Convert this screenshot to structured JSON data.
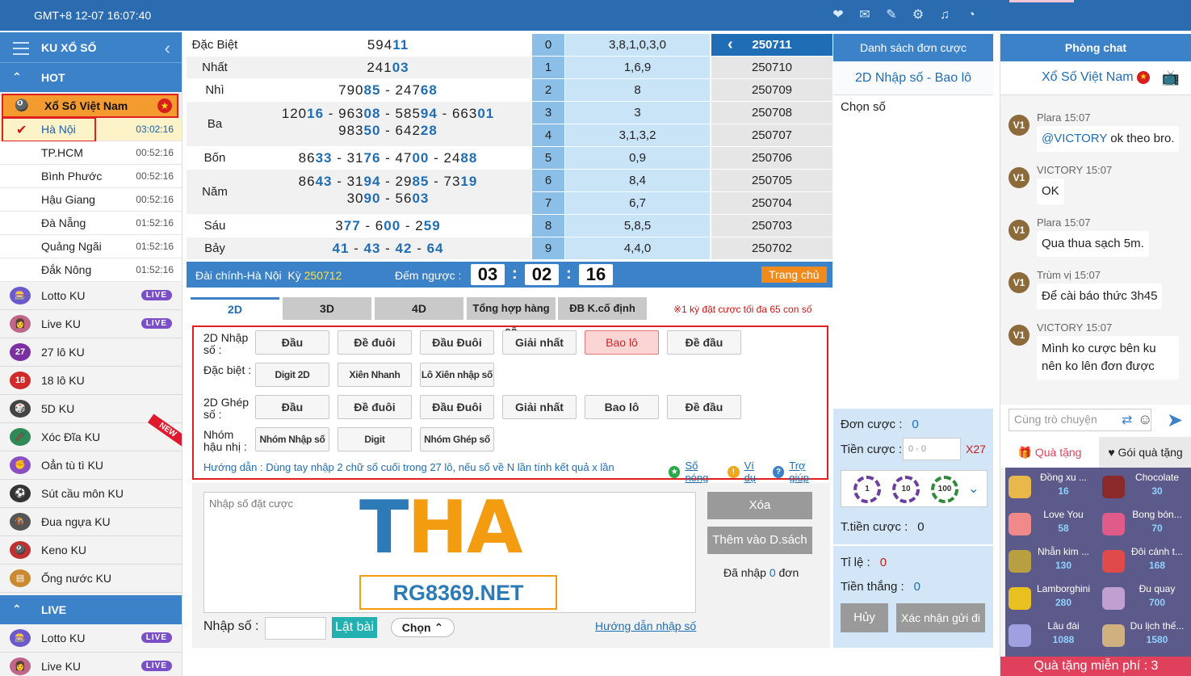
{
  "topbar": {
    "clock": "GMT+8 12-07 16:07:40"
  },
  "sidebar": {
    "title": "KU XỔ SỐ",
    "hot_label": "HOT",
    "vn_label": "Xổ Số Việt Nam",
    "cities": [
      {
        "name": "Hà Nội",
        "time": "03:02:16"
      },
      {
        "name": "TP.HCM",
        "time": "00:52:16"
      },
      {
        "name": "Bình Phước",
        "time": "00:52:16"
      },
      {
        "name": "Hậu Giang",
        "time": "00:52:16"
      },
      {
        "name": "Đà Nẵng",
        "time": "01:52:16"
      },
      {
        "name": "Quảng Ngãi",
        "time": "01:52:16"
      },
      {
        "name": "Đắk Nông",
        "time": "01:52:16"
      }
    ],
    "games": [
      {
        "name": "Lotto KU",
        "badge": "LIVE"
      },
      {
        "name": "Live KU",
        "badge": "LIVE"
      },
      {
        "name": "27 lô KU",
        "icon": "27"
      },
      {
        "name": "18 lô KU",
        "icon": "18"
      },
      {
        "name": "5D KU"
      },
      {
        "name": "Xóc Đĩa KU",
        "badge": "NEW"
      },
      {
        "name": "Oẳn tù tì KU"
      },
      {
        "name": "Sút cầu môn KU"
      },
      {
        "name": "Đua ngựa KU"
      },
      {
        "name": "Keno KU"
      },
      {
        "name": "Ống nước KU"
      }
    ],
    "live_label": "LIVE",
    "live_games": [
      {
        "name": "Lotto KU",
        "badge": "LIVE"
      },
      {
        "name": "Live KU",
        "badge": "LIVE"
      }
    ]
  },
  "results": {
    "prizes": [
      {
        "name": "Đặc Biệt",
        "lines": [
          [
            [
              "594",
              "11"
            ]
          ]
        ]
      },
      {
        "name": "Nhất",
        "lines": [
          [
            [
              "241",
              "03"
            ]
          ]
        ]
      },
      {
        "name": "Nhì",
        "lines": [
          [
            [
              "790",
              "85"
            ],
            [
              "247",
              "68"
            ]
          ]
        ]
      },
      {
        "name": "Ba",
        "lines": [
          [
            [
              "120",
              "16"
            ],
            [
              "963",
              "08"
            ],
            [
              "585",
              "94"
            ],
            [
              "663",
              "01"
            ]
          ],
          [
            [
              "983",
              "50"
            ],
            [
              "642",
              "28"
            ]
          ]
        ]
      },
      {
        "name": "Bốn",
        "lines": [
          [
            [
              "86",
              "33"
            ],
            [
              "31",
              "76"
            ],
            [
              "47",
              "00"
            ],
            [
              "24",
              "88"
            ]
          ]
        ]
      },
      {
        "name": "Năm",
        "lines": [
          [
            [
              "86",
              "43"
            ],
            [
              "31",
              "94"
            ],
            [
              "29",
              "85"
            ],
            [
              "73",
              "19"
            ]
          ],
          [
            [
              "30",
              "90"
            ],
            [
              "56",
              "03"
            ]
          ]
        ]
      },
      {
        "name": "Sáu",
        "lines": [
          [
            [
              "3",
              "77"
            ],
            [
              "6",
              "00"
            ],
            [
              "2",
              "59"
            ]
          ]
        ]
      },
      {
        "name": "Bảy",
        "lines": [
          [
            [
              "",
              "41"
            ],
            [
              "",
              "43"
            ],
            [
              "",
              "42"
            ],
            [
              "",
              "64"
            ]
          ]
        ]
      }
    ],
    "digits": [
      {
        "idx": "0",
        "val": "3,8,1,0,3,0"
      },
      {
        "idx": "1",
        "val": "1,6,9"
      },
      {
        "idx": "2",
        "val": "8"
      },
      {
        "idx": "3",
        "val": "3"
      },
      {
        "idx": "4",
        "val": "3,1,3,2"
      },
      {
        "idx": "5",
        "val": "0,9"
      },
      {
        "idx": "6",
        "val": "8,4"
      },
      {
        "idx": "7",
        "val": "6,7"
      },
      {
        "idx": "8",
        "val": "5,8,5"
      },
      {
        "idx": "9",
        "val": "4,4,0"
      }
    ],
    "periods": [
      "250711",
      "250710",
      "250709",
      "250708",
      "250707",
      "250706",
      "250705",
      "250704",
      "250703",
      "250702"
    ]
  },
  "countdown": {
    "station": "Đài chính-Hà Nội",
    "ky_label": "Kỳ",
    "ky": "250712",
    "label": "Đếm ngược :",
    "h": "03",
    "m": "02",
    "s": "16",
    "home": "Trang chủ"
  },
  "tabs": {
    "items": [
      "2D",
      "3D",
      "4D",
      "Tổng hợp hàng số",
      "ĐB K.cố định"
    ],
    "note": "※1 kỳ đặt cược tối đa 65 con số"
  },
  "bettypes": {
    "rows": [
      {
        "label": "2D Nhập số :",
        "buttons": [
          "Đầu",
          "Đề đuôi",
          "Đầu Đuôi",
          "Giải nhất",
          "Bao lô",
          "Đề đầu"
        ]
      },
      {
        "label": "Đặc biệt :",
        "buttons": [
          "Digit 2D",
          "Xiên Nhanh",
          "Lô Xiên nhập số"
        ]
      },
      {
        "label": "2D Ghép số :",
        "buttons": [
          "Đầu",
          "Đề đuôi",
          "Đầu Đuôi",
          "Giải nhất",
          "Bao lô",
          "Đề đầu"
        ]
      },
      {
        "label": "Nhóm hậu nhị :",
        "buttons": [
          "Nhóm Nhập số",
          "Digit",
          "Nhóm Ghép số"
        ]
      }
    ],
    "guide": "Hướng dẫn : Dùng tay nhập 2 chữ số cuối trong 27 lô, nếu số về N lần tính kết quả x lần",
    "link_hot": "Số nóng",
    "link_example": "Ví dụ",
    "link_help": "Trợ giúp"
  },
  "input": {
    "placeholder": "Nhập số đặt cược",
    "logo_text": "THA",
    "logo_url": "RG8369.NET",
    "delete": "Xóa",
    "add": "Thêm vào D.sách",
    "entered_pre": "Đã nhập",
    "entered_count": "0",
    "entered_post": "đơn",
    "number_label": "Nhập số :",
    "flip": "Lật bài",
    "choose": "Chọn",
    "guide_link": "Hướng dẫn nhập số"
  },
  "orders": {
    "title": "Danh sách đơn cược",
    "type": "2D Nhập số - Bao lô",
    "choose": "Chọn số",
    "order_label": "Đơn cược :",
    "order_val": "0",
    "bet_label": "Tiền cược :",
    "bet_placeholder": "0 - 0",
    "multiplier": "X27",
    "chips": [
      "1",
      "10",
      "100"
    ],
    "total_label": "T.tiền cược :",
    "total_val": "0",
    "rate_label": "Tỉ lệ :",
    "rate_val": "0",
    "win_label": "Tiền thắng :",
    "win_val": "0",
    "cancel": "Hủy",
    "confirm": "Xác nhận gửi đi"
  },
  "chat": {
    "title": "Phòng chat",
    "room": "Xổ Số Việt Nam",
    "messages": [
      {
        "user": "Plara 15:07",
        "tag": "@VICTORY",
        "text": " ok theo bro."
      },
      {
        "user": "VICTORY 15:07",
        "tag": "",
        "text": "OK"
      },
      {
        "user": "Plara 15:07",
        "tag": "",
        "text": "Qua thua sạch 5m."
      },
      {
        "user": "Trùm vị 15:07",
        "tag": "",
        "text": "Để cài báo thức 3h45"
      },
      {
        "user": "VICTORY 15:07",
        "tag": "",
        "text": "Mình ko cược bên ku nên ko lên đơn được"
      }
    ],
    "avatar_label": "V1",
    "input_placeholder": "Cùng trò chuyện",
    "tab_gift": "Quà tặng",
    "tab_pack": "Gói quà tặng",
    "gifts": [
      {
        "name": "Đồng xu ...",
        "price": "16"
      },
      {
        "name": "Chocolate",
        "price": "30"
      },
      {
        "name": "Love You",
        "price": "58"
      },
      {
        "name": "Bong bón...",
        "price": "70"
      },
      {
        "name": "Nhẫn kim ...",
        "price": "130"
      },
      {
        "name": "Đôi cánh t...",
        "price": "168"
      },
      {
        "name": "Lamborghini",
        "price": "280"
      },
      {
        "name": "Đu quay",
        "price": "700"
      },
      {
        "name": "Lâu đài",
        "price": "1088"
      },
      {
        "name": "Du lịch thế...",
        "price": "1580"
      }
    ],
    "free_label": "Quà tặng miễn phí :",
    "free_count": "3"
  }
}
